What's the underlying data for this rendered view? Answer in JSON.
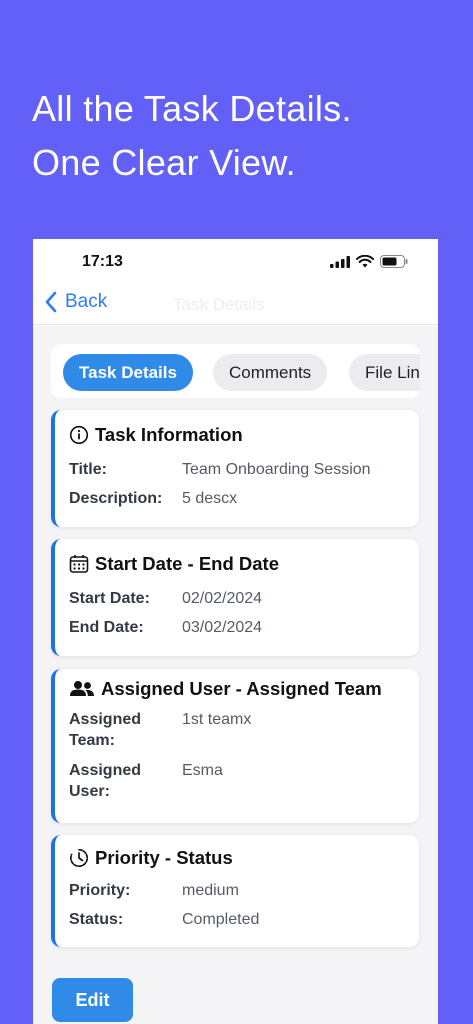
{
  "headline": {
    "line1": "All the Task Details.",
    "line2": "One Clear View."
  },
  "status_bar": {
    "time": "17:13"
  },
  "nav": {
    "back_label": "Back",
    "title": "Task Details"
  },
  "tabs": [
    {
      "label": "Task Details",
      "active": true
    },
    {
      "label": "Comments",
      "active": false
    },
    {
      "label": "File Links",
      "active": false
    }
  ],
  "cards": {
    "task_info": {
      "title": "Task Information",
      "icon": "info-icon",
      "rows": [
        {
          "label": "Title:",
          "value": "Team Onboarding Session"
        },
        {
          "label": "Description:",
          "value": "5 descx"
        }
      ]
    },
    "dates": {
      "title": "Start Date - End Date",
      "icon": "calendar-icon",
      "rows": [
        {
          "label": "Start Date:",
          "value": "02/02/2024"
        },
        {
          "label": "End Date:",
          "value": "03/02/2024"
        }
      ]
    },
    "assigned": {
      "title": "Assigned User - Assigned Team",
      "icon": "users-icon",
      "rows": [
        {
          "label_line1": "Assigned",
          "label_line2": "Team:",
          "value": "1st teamx"
        },
        {
          "label_line1": "Assigned",
          "label_line2": "User:",
          "value": "Esma"
        }
      ]
    },
    "priority": {
      "title": "Priority - Status",
      "icon": "clock-icon",
      "rows": [
        {
          "label": "Priority:",
          "value": "medium"
        },
        {
          "label": "Status:",
          "value": "Completed"
        }
      ]
    }
  },
  "edit_label": "Edit",
  "colors": {
    "background": "#6360F8",
    "accent": "#2F8AE8",
    "card_border": "#1E73E0",
    "link": "#2F7CF6"
  }
}
